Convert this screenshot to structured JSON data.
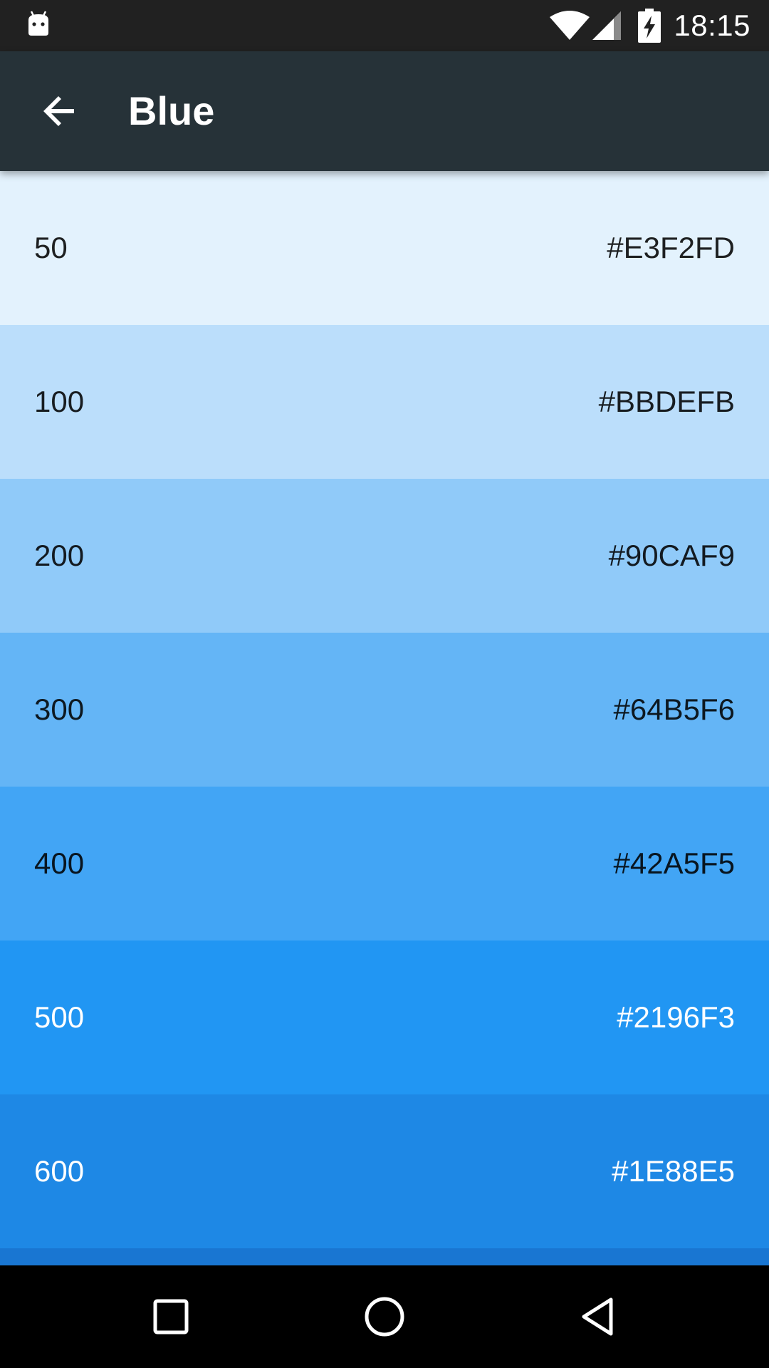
{
  "status_bar": {
    "time": "18:15",
    "icons": [
      "android-icon",
      "wifi-icon",
      "signal-icon",
      "battery-charging-icon"
    ]
  },
  "app_bar": {
    "title": "Blue",
    "back_icon": "arrow-back-icon",
    "background": "#263238"
  },
  "swatches": [
    {
      "shade": "50",
      "hex": "#E3F2FD",
      "color": "#E3F2FD",
      "text": "dark"
    },
    {
      "shade": "100",
      "hex": "#BBDEFB",
      "color": "#BBDEFB",
      "text": "dark"
    },
    {
      "shade": "200",
      "hex": "#90CAF9",
      "color": "#90CAF9",
      "text": "dark"
    },
    {
      "shade": "300",
      "hex": "#64B5F6",
      "color": "#64B5F6",
      "text": "dark"
    },
    {
      "shade": "400",
      "hex": "#42A5F5",
      "color": "#42A5F5",
      "text": "dark"
    },
    {
      "shade": "500",
      "hex": "#2196F3",
      "color": "#2196F3",
      "text": "light"
    },
    {
      "shade": "600",
      "hex": "#1E88E5",
      "color": "#1E88E5",
      "text": "light"
    },
    {
      "shade": "",
      "hex": "",
      "color": "#1976D2",
      "text": "light"
    }
  ],
  "nav_bar": {
    "icons": [
      "recents-square-icon",
      "home-circle-icon",
      "back-triangle-icon"
    ]
  }
}
